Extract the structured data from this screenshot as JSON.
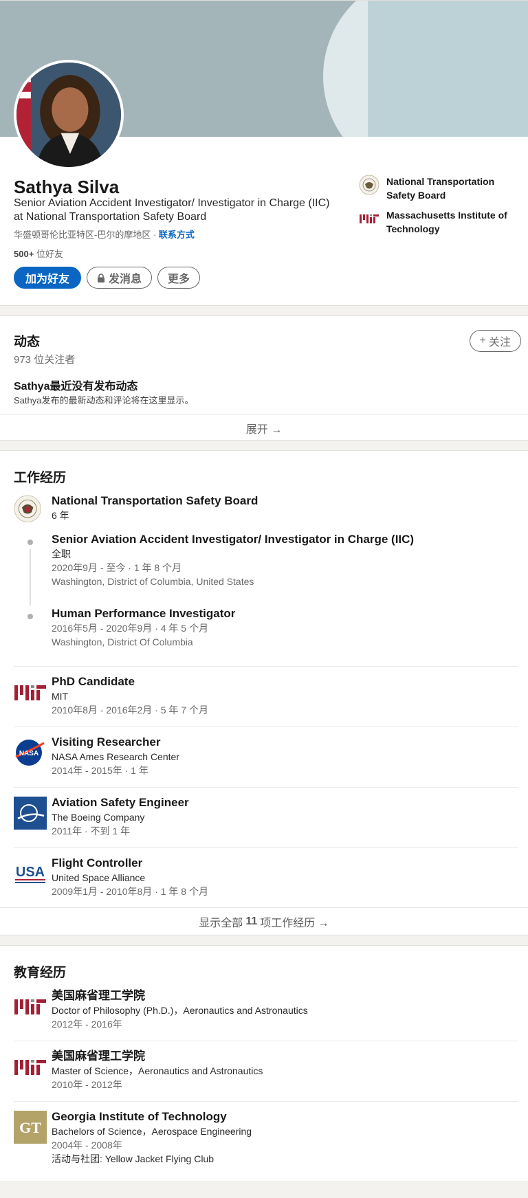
{
  "profile": {
    "name": "Sathya Silva",
    "headline": "Senior Aviation Accident Investigator/ Investigator in Charge (IIC) at National Transportation Safety Board",
    "location": "华盛顿哥伦比亚特区-巴尔的摩地区 · ",
    "contact_link": "联系方式",
    "friends_count": "500+",
    "friends_label": " 位好友",
    "buttons": {
      "add_friend": "加为好友",
      "message": "发消息",
      "more": "更多"
    },
    "orgs": [
      {
        "name": "National Transportation Safety Board",
        "icon": "ntsb-seal-icon"
      },
      {
        "name": "Massachusetts Institute of Technology",
        "icon": "mit-logo-icon"
      }
    ]
  },
  "activity": {
    "title": "动态",
    "followers": "973 位关注者",
    "follow_button": "关注",
    "no_post_title": "Sathya最近没有发布动态",
    "no_post_desc": "Sathya发布的最新动态和评论将在这里显示。",
    "expand": "展开 →"
  },
  "experience": {
    "title": "工作经历",
    "ntsb": {
      "company": "National Transportation Safety Board",
      "duration": "6 年",
      "roles": [
        {
          "title": "Senior Aviation Accident Investigator/ Investigator in Charge (IIC)",
          "type": "全职",
          "dates": "2020年9月 - 至今 · 1 年 8 个月",
          "location": "Washington, District of Columbia, United States"
        },
        {
          "title": "Human Performance Investigator",
          "dates": "2016年5月 - 2020年9月 · 4 年 5 个月",
          "location": "Washington, District Of Columbia"
        }
      ]
    },
    "items": [
      {
        "title": "PhD Candidate",
        "company": "MIT",
        "dates": "2010年8月 - 2016年2月 · 5 年 7 个月",
        "icon": "mit-logo-icon"
      },
      {
        "title": "Visiting Researcher",
        "company": "NASA Ames Research Center",
        "dates": "2014年 - 2015年 · 1 年",
        "icon": "nasa-logo-icon"
      },
      {
        "title": "Aviation Safety Engineer",
        "company": "The Boeing Company",
        "dates": "2011年 · 不到 1 年",
        "icon": "boeing-logo-icon"
      },
      {
        "title": "Flight Controller",
        "company": "United Space Alliance",
        "dates": "2009年1月 - 2010年8月 · 1 年 8 个月",
        "icon": "usa-logo-icon"
      }
    ],
    "show_all_prefix": "显示全部",
    "show_all_count": "11",
    "show_all_suffix": "项工作经历 →"
  },
  "education": {
    "title": "教育经历",
    "items": [
      {
        "school": "美国麻省理工学院",
        "degree": "Doctor of Philosophy (Ph.D.)，Aeronautics and Astronautics",
        "dates": "2012年 - 2016年",
        "icon": "mit-logo-icon"
      },
      {
        "school": "美国麻省理工学院",
        "degree": "Master of Science，Aeronautics and Astronautics",
        "dates": "2010年 - 2012年",
        "icon": "mit-logo-icon"
      },
      {
        "school": "Georgia Institute of Technology",
        "degree": "Bachelors of Science，Aerospace Engineering",
        "dates": "2004年 - 2008年",
        "activities": "活动与社团: Yellow Jacket Flying Club",
        "icon": "gt-logo-icon",
        "logo_text": "GT"
      }
    ]
  },
  "colors": {
    "accent": "#0a66c2",
    "mit": "#a31f34",
    "nasa": "#0b3d91",
    "boeing": "#1d4f91",
    "gt_gold": "#b3a369"
  }
}
